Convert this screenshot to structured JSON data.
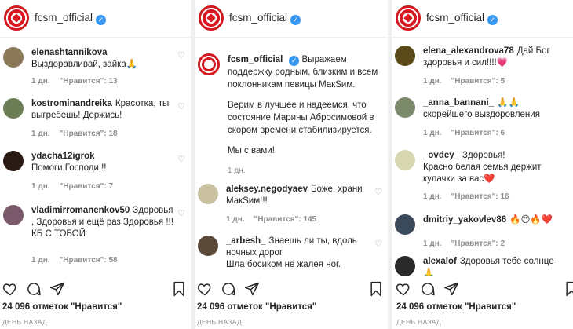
{
  "account": {
    "username": "fcsm_official",
    "brand_color": "#d71a21",
    "verified_color": "#3897f0"
  },
  "panels": [
    {
      "comments": [
        {
          "user": "elenashtannikova",
          "text": "Выздоравливай, зайка🙏",
          "time": "1 дн.",
          "likes": "\"Нравится\": 13",
          "avatar_color": "#8a7a5a"
        },
        {
          "user": "kostrominandreika",
          "text": "Красотка, ты выгребешь! Держись!",
          "time": "1 дн.",
          "likes": "\"Нравится\": 18",
          "avatar_color": "#6a7d55"
        },
        {
          "user": "ydacha12igrok",
          "text": "Помоги,Господи!!!",
          "time": "1 дн.",
          "likes": "\"Нравится\": 7",
          "avatar_color": "#2a1a14"
        },
        {
          "user": "vladimirromanenkov50",
          "text": "Здоровья , Здоровья и ещё раз Здоровья !!!",
          "text2": "КБ С ТОБОЙ",
          "time": "1 дн.",
          "likes": "\"Нравится\": 58",
          "avatar_color": "#7a5a6a"
        }
      ],
      "likes_total": "24 096 отметок \"Нравится\"",
      "day_label": "ДЕНЬ НАЗАД"
    },
    {
      "caption": {
        "user": "fcsm_official",
        "p1": "Выражаем поддержку родным, близким и всем поклонникам певицы МакSим.",
        "p2": "Верим в лучшее и надеемся, что состояние Марины Абросимовой в скором времени стабилизируется.",
        "p3": "Мы с вами!",
        "time": "1 дн."
      },
      "comments": [
        {
          "user": "aleksey.negodyaev",
          "text": "Боже, храни МакSим!!!",
          "time": "1 дн.",
          "likes": "\"Нравится\": 145",
          "avatar_color": "#c8c0a0"
        },
        {
          "user": "_arbesh_",
          "text": "Знаешь ли ты, вдоль ночных дорог",
          "text2": "Шла босиком не жалея ног.",
          "avatar_color": "#5a4a3a"
        }
      ],
      "likes_total": "24 096 отметок \"Нравится\"",
      "day_label": "ДЕНЬ НАЗАД"
    },
    {
      "comments": [
        {
          "user": "elena_alexandrova78",
          "text": "Дай Бог здоровья и сил!!!!💗",
          "time": "1 дн.",
          "likes": "\"Нравится\": 5",
          "avatar_color": "#5a4a1a"
        },
        {
          "user": "_anna_bannani_",
          "text": "🙏🙏скорейшего выздоровления",
          "time": "1 дн.",
          "likes": "\"Нравится\": 6",
          "avatar_color": "#7a8a6a"
        },
        {
          "user": "_ovdey_",
          "text": "Здоровья!",
          "text2": "Красно белая семья держит кулачки за вас❤️",
          "time": "1 дн.",
          "likes": "\"Нравится\": 16",
          "avatar_color": "#d8d8b0"
        },
        {
          "user": "dmitriy_yakovlev86",
          "text": "🔥😍🔥❤️",
          "time": "1 дн.",
          "likes": "\"Нравится\": 2",
          "avatar_color": "#3a4a5a"
        },
        {
          "user": "alexalof",
          "text": "Здоровья тебе солнце",
          "text2": "🙏",
          "avatar_color": "#2a2a2a"
        }
      ],
      "likes_total": "24 096 отметок \"Нравится\"",
      "day_label": "ДЕНЬ НАЗАД"
    }
  ],
  "icons": [
    "verified-icon",
    "heart-icon",
    "comment-icon",
    "share-icon",
    "bookmark-icon"
  ]
}
